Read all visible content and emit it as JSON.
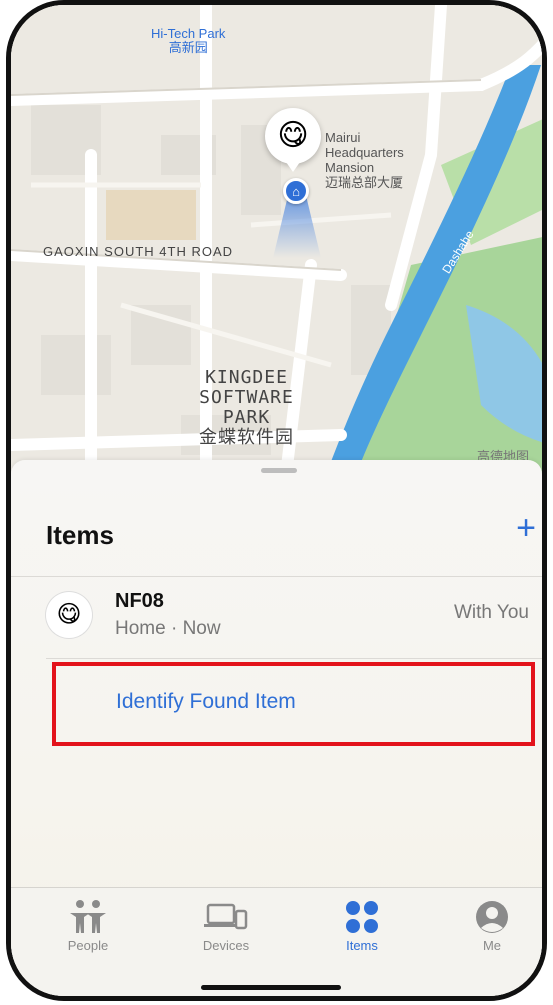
{
  "map": {
    "labels": {
      "hitech_en": "Hi-Tech Park",
      "hitech_cn": "高新园",
      "mairui_1": "Mairui",
      "mairui_2": "Headquarters",
      "mairui_3": "Mansion",
      "mairui_cn": "迈瑞总部大厦",
      "road": "GAOXIN SOUTH 4TH ROAD",
      "kingdee_1": "KINGDEE",
      "kingdee_2": "SOFTWARE",
      "kingdee_3": "PARK",
      "kingdee_cn": "金蝶软件园",
      "river": "Dashahe",
      "provider": "高德地图"
    },
    "pin_emoji": "😋",
    "home_icon": "house-icon"
  },
  "sheet": {
    "title": "Items",
    "add_label": "+",
    "items": [
      {
        "emoji": "😋",
        "name": "NF08",
        "subtitle": "Home · Now",
        "status": "With You"
      }
    ],
    "identify_label": "Identify Found Item"
  },
  "tabbar": {
    "tabs": [
      {
        "label": "People",
        "icon": "people-icon",
        "active": false
      },
      {
        "label": "Devices",
        "icon": "devices-icon",
        "active": false
      },
      {
        "label": "Items",
        "icon": "items-icon",
        "active": true
      },
      {
        "label": "Me",
        "icon": "person-circle-icon",
        "active": false
      }
    ]
  },
  "colors": {
    "accent": "#2f6fd6",
    "highlight": "#e3131b",
    "river": "#4ba0e0",
    "park": "#a8d59a"
  }
}
